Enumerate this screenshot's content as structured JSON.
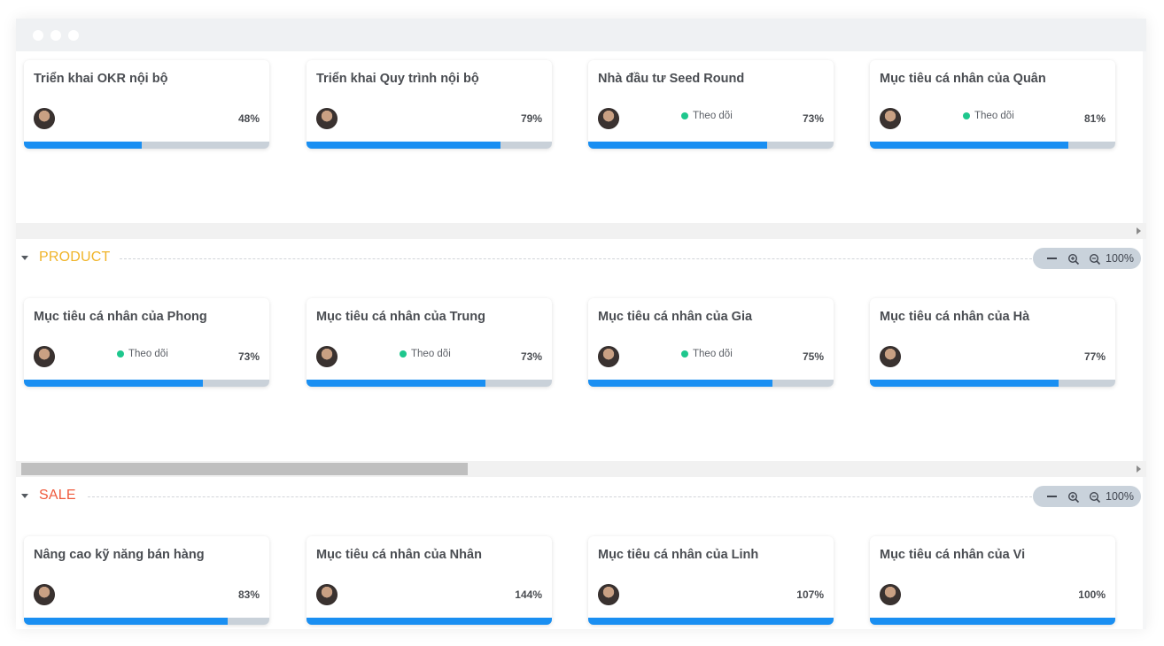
{
  "colors": {
    "progress_fill": "#1a8ff2",
    "progress_track": "#c9d1d9",
    "follow_dot": "#1ec78d",
    "product_group": "#f0b429",
    "sale_group": "#ef5a3c"
  },
  "follow_label": "Theo dõi",
  "groups": [
    {
      "cards": [
        {
          "title": "Triển khai OKR nội bộ",
          "percent": "48%",
          "progress": 0.48,
          "following": false,
          "avatar_icon": "user-avatar"
        },
        {
          "title": "Triển khai Quy trình nội bộ",
          "percent": "79%",
          "progress": 0.79,
          "following": false,
          "avatar_icon": "user-avatar"
        },
        {
          "title": "Nhà đầu tư Seed Round",
          "percent": "73%",
          "progress": 0.73,
          "following": true,
          "avatar_icon": "user-avatar"
        },
        {
          "title": "Mục tiêu cá nhân của Quân",
          "percent": "81%",
          "progress": 0.81,
          "following": true,
          "avatar_icon": "user-avatar"
        }
      ]
    },
    {
      "name": "PRODUCT",
      "zoom": "100%",
      "cards": [
        {
          "title": "Mục tiêu cá nhân của Phong",
          "percent": "73%",
          "progress": 0.73,
          "following": true,
          "avatar_icon": "user-avatar"
        },
        {
          "title": "Mục tiêu cá nhân của Trung",
          "percent": "73%",
          "progress": 0.73,
          "following": true,
          "avatar_icon": "user-avatar"
        },
        {
          "title": "Mục tiêu cá nhân của Gia",
          "percent": "75%",
          "progress": 0.75,
          "following": true,
          "avatar_icon": "user-avatar"
        },
        {
          "title": "Mục tiêu cá nhân của Hà",
          "percent": "77%",
          "progress": 0.77,
          "following": false,
          "avatar_icon": "user-avatar"
        }
      ]
    },
    {
      "name": "SALE",
      "zoom": "100%",
      "cards": [
        {
          "title": "Nâng cao kỹ năng bán hàng",
          "percent": "83%",
          "progress": 0.83,
          "following": false,
          "avatar_icon": "user-avatar"
        },
        {
          "title": "Mục tiêu cá nhân của Nhân",
          "percent": "144%",
          "progress": 1.0,
          "following": false,
          "avatar_icon": "user-avatar"
        },
        {
          "title": "Mục tiêu cá nhân của Linh",
          "percent": "107%",
          "progress": 1.0,
          "following": false,
          "avatar_icon": "user-avatar"
        },
        {
          "title": "Mục tiêu cá nhân của Vi",
          "percent": "100%",
          "progress": 1.0,
          "following": false,
          "avatar_icon": "user-avatar"
        }
      ]
    }
  ],
  "zoom_icons": [
    "zoom-reset-icon",
    "zoom-in-icon",
    "zoom-out-icon"
  ]
}
